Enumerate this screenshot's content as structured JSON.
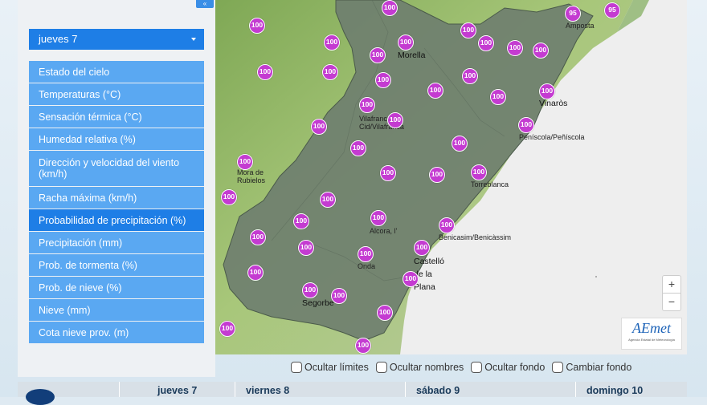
{
  "sidebar": {
    "day_selected": "jueves 7",
    "items": [
      {
        "label": "Estado del cielo",
        "active": false
      },
      {
        "label": "Temperaturas (°C)",
        "active": false
      },
      {
        "label": "Sensación térmica (°C)",
        "active": false
      },
      {
        "label": "Humedad relativa (%)",
        "active": false
      },
      {
        "label": "Dirección y velocidad del viento (km/h)",
        "active": false
      },
      {
        "label": "Racha máxima (km/h)",
        "active": false
      },
      {
        "label": "Probabilidad de precipitación (%)",
        "active": true
      },
      {
        "label": "Precipitación (mm)",
        "active": false
      },
      {
        "label": "Prob. de tormenta (%)",
        "active": false
      },
      {
        "label": "Prob. de nieve (%)",
        "active": false
      },
      {
        "label": "Nieve (mm)",
        "active": false
      },
      {
        "label": "Cota nieve prov. (m)",
        "active": false
      }
    ]
  },
  "map": {
    "cities": [
      {
        "name": "Morella"
      },
      {
        "name": "Amposta"
      },
      {
        "name": "Vinaròs"
      },
      {
        "name": "Vilafranca del Cid/Vilafranca"
      },
      {
        "name": "Peníscola/Peñíscola"
      },
      {
        "name": "Mora de Rubielos"
      },
      {
        "name": "Torreblanca"
      },
      {
        "name": "Alcora, l'"
      },
      {
        "name": "Benicasim/Benicàssim"
      },
      {
        "name": "Onda"
      },
      {
        "name": "Castelló de la Plana"
      },
      {
        "name": "Segorbe"
      }
    ],
    "markers": [
      "100",
      "100",
      "95",
      "95",
      "100",
      "100",
      "100",
      "100",
      "100",
      "100",
      "100",
      "100",
      "100",
      "100",
      "100",
      "100",
      "100",
      "100",
      "100",
      "100",
      "100",
      "100",
      "100",
      "100",
      "100",
      "100",
      "100",
      "100",
      "100",
      "100",
      "100",
      "100",
      "100",
      "100",
      "100",
      "100",
      "100",
      "100",
      "100",
      "100",
      "100",
      "100",
      "100",
      "100"
    ],
    "marker_color": "#c43bd1",
    "zoom_in": "+",
    "zoom_out": "−",
    "logo_text": "AEmet",
    "logo_subtext": "Agencia Estatal de Meteorología"
  },
  "toggles": [
    {
      "label": "Ocultar límites"
    },
    {
      "label": "Ocultar nombres"
    },
    {
      "label": "Ocultar fondo"
    },
    {
      "label": "Cambiar fondo"
    }
  ],
  "day_tabs": [
    {
      "label": "jueves 7"
    },
    {
      "label": "viernes 8"
    },
    {
      "label": "sábado 9"
    },
    {
      "label": "domingo 10"
    }
  ],
  "colors": {
    "accent": "#1e7ee6",
    "menu_item": "#5aa8f2",
    "region_fill": "#6f7f6f",
    "terrain": "#8fb65a"
  }
}
